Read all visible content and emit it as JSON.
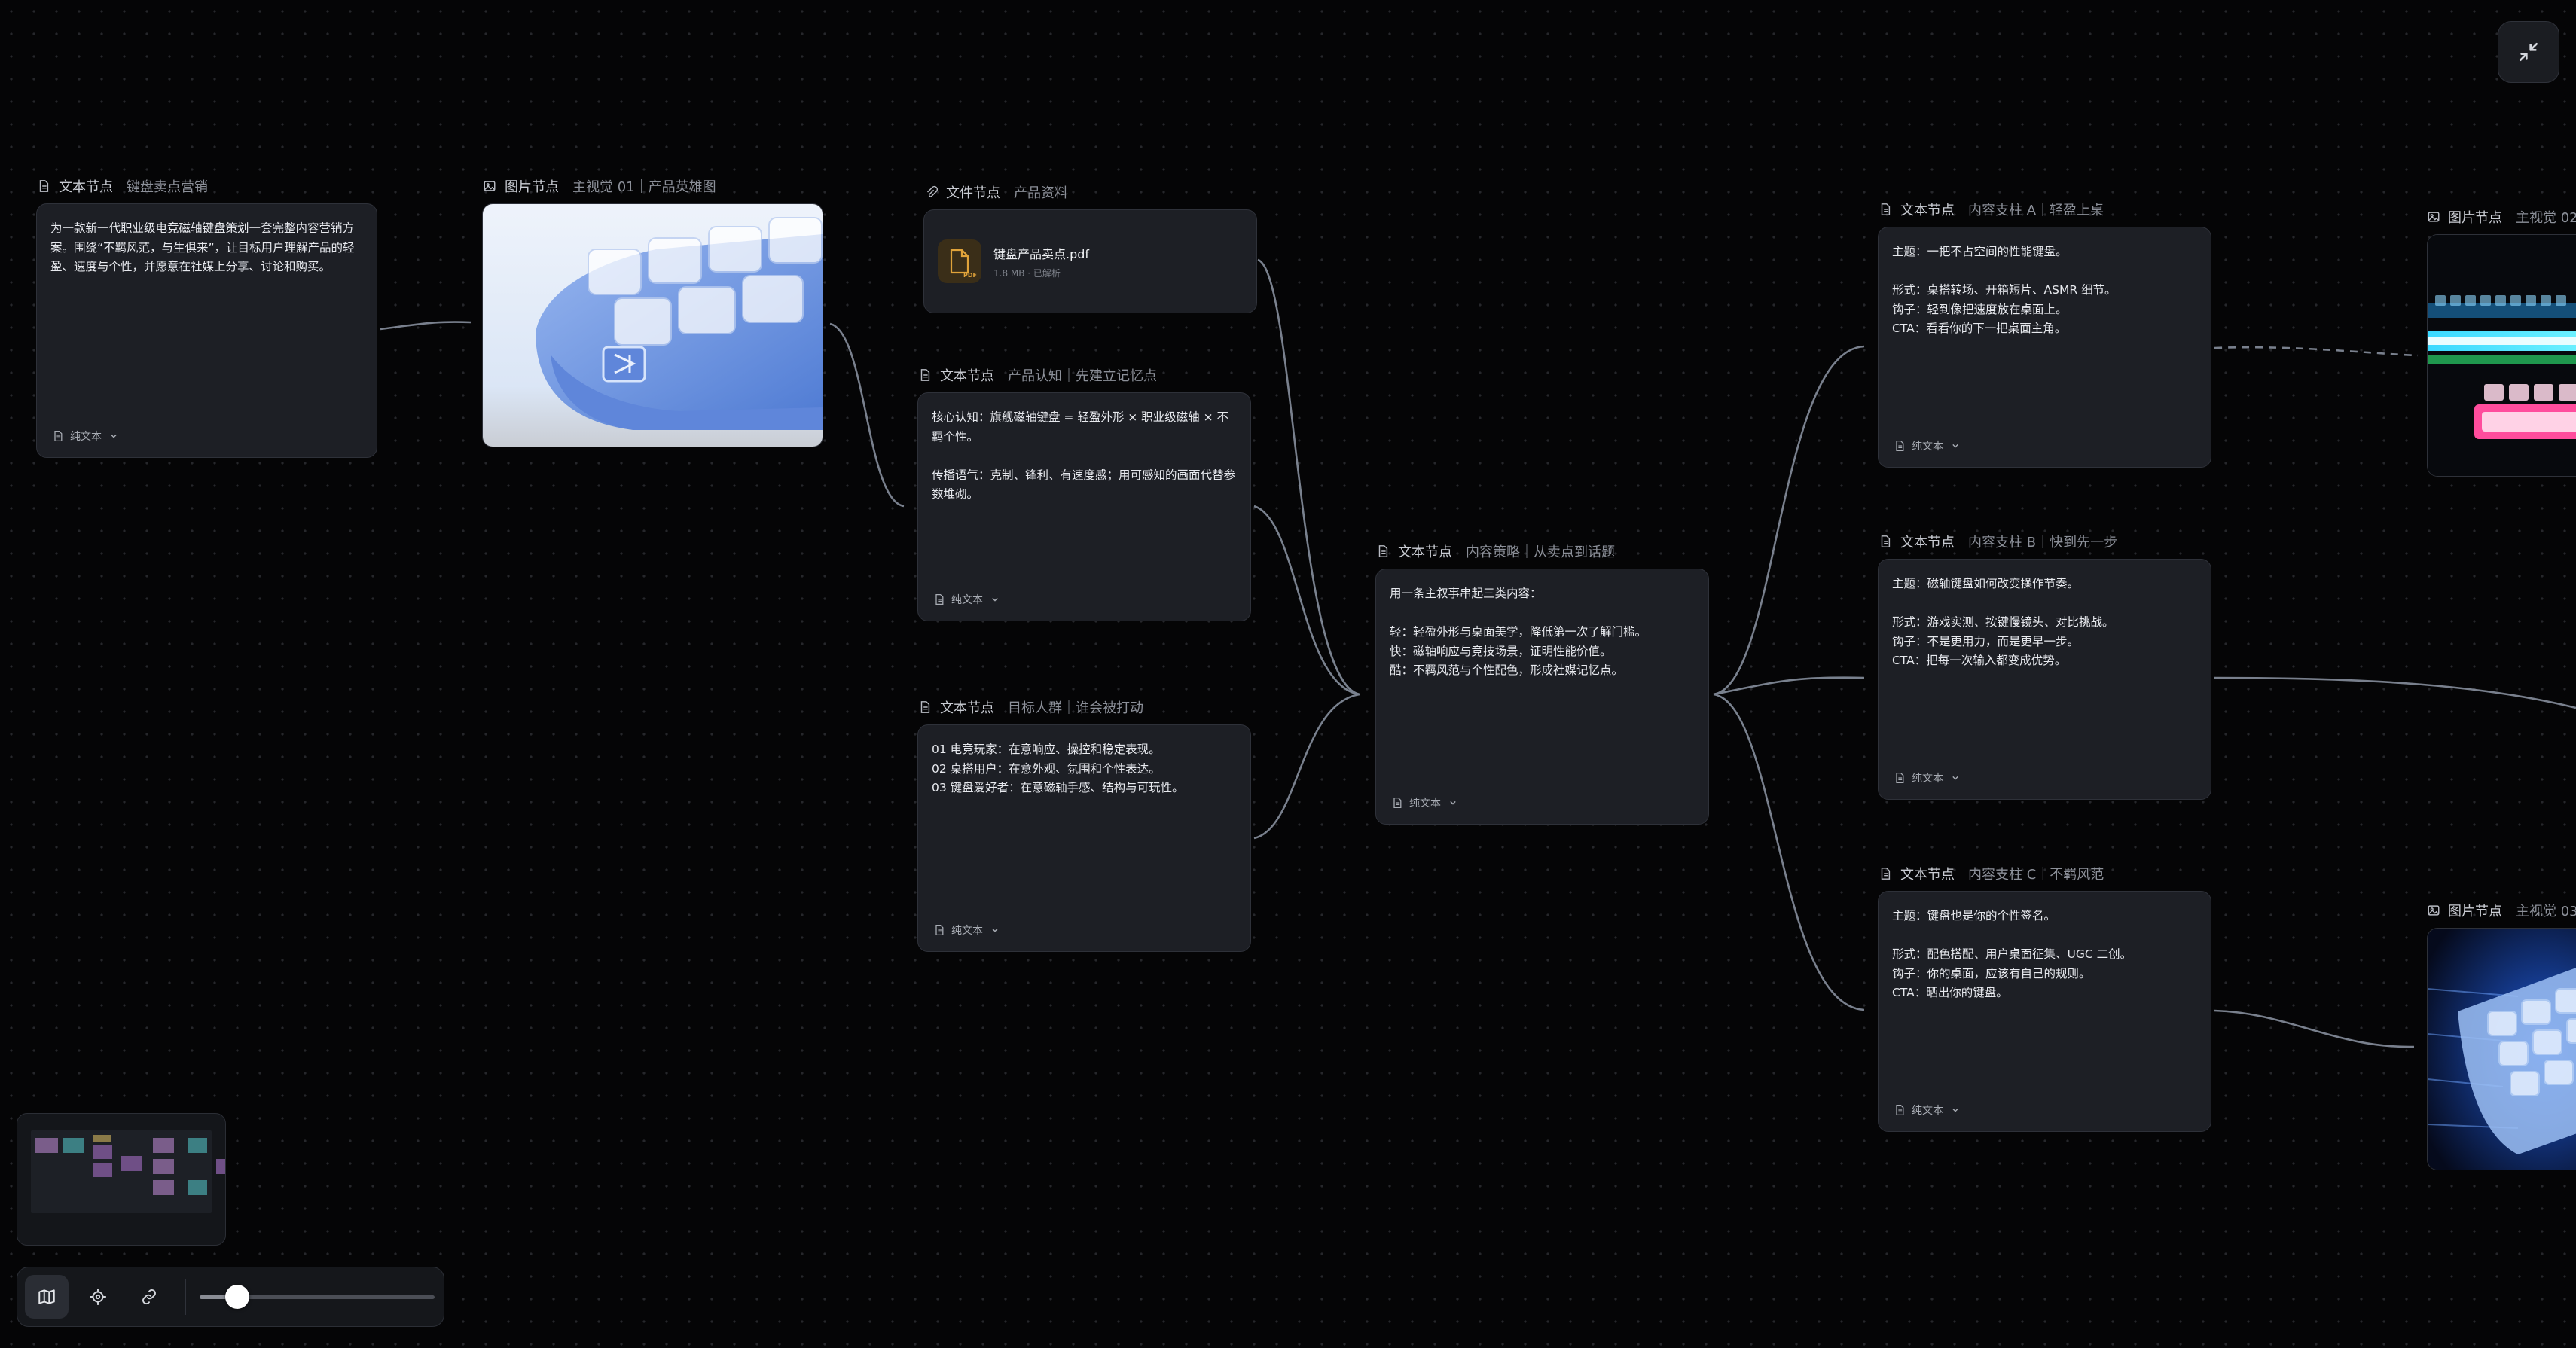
{
  "nodes": {
    "marketing": {
      "type": "文本节点",
      "title": "键盘卖点营销",
      "body": "为一款新一代职业级电竞磁轴键盘策划一套完整内容营销方案。围绕“不羁风范，与生俱来”，让目标用户理解产品的轻盈、速度与个性，并愿意在社媒上分享、讨论和购买。",
      "format": "纯文本"
    },
    "hero_image": {
      "type": "图片节点",
      "title": "主视觉 01｜产品英雄图"
    },
    "file": {
      "type": "文件节点",
      "title": "产品资料",
      "file_name": "键盘产品卖点.pdf",
      "file_meta": "1.8 MB · 已解析",
      "file_badge": "PDF"
    },
    "cognition": {
      "type": "文本节点",
      "title": "产品认知｜先建立记忆点",
      "body": "核心认知：旗舰磁轴键盘 = 轻盈外形 × 职业级磁轴 × 不羁个性。\n\n传播语气：克制、锋利、有速度感；用可感知的画面代替参数堆砌。",
      "format": "纯文本"
    },
    "audience": {
      "type": "文本节点",
      "title": "目标人群｜谁会被打动",
      "body": "01 电竞玩家：在意响应、操控和稳定表现。\n02 桌搭用户：在意外观、氛围和个性表达。\n03 键盘爱好者：在意磁轴手感、结构与可玩性。",
      "format": "纯文本"
    },
    "strategy": {
      "type": "文本节点",
      "title": "内容策略｜从卖点到话题",
      "body": "用一条主叙事串起三类内容：\n\n轻：轻盈外形与桌面美学，降低第一次了解门槛。\n快：磁轴响应与竞技场景，证明性能价值。\n酷：不羁风范与个性配色，形成社媒记忆点。",
      "format": "纯文本"
    },
    "pillar_a": {
      "type": "文本节点",
      "title": "内容支柱 A｜轻盈上桌",
      "body": "主题：一把不占空间的性能键盘。\n\n形式：桌搭转场、开箱短片、ASMR 细节。\n钩子：轻到像把速度放在桌面上。\nCTA：看看你的下一把桌面主角。",
      "format": "纯文本"
    },
    "pillar_b": {
      "type": "文本节点",
      "title": "内容支柱 B｜快到先一步",
      "body": "主题：磁轴键盘如何改变操作节奏。\n\n形式：游戏实测、按键慢镜头、对比挑战。\n钩子：不是更用力，而是更早一步。\nCTA：把每一次输入都变成优势。",
      "format": "纯文本"
    },
    "pillar_c": {
      "type": "文本节点",
      "title": "内容支柱 C｜不羁风范",
      "body": "主题：键盘也是你的个性签名。\n\n形式：配色搭配、用户桌面征集、UGC 二创。\n钩子：你的桌面，应该有自己的规则。\nCTA：晒出你的键盘。",
      "format": "纯文本"
    },
    "image_02": {
      "type": "图片节点",
      "title": "主视觉 02"
    },
    "image_03": {
      "type": "图片节点",
      "title": "主视觉 03"
    }
  },
  "toolbar": {
    "zoom_fraction": 0.16
  },
  "colors": {
    "canvas": "#050506",
    "card": "#1d1f25",
    "edge": "#8e97a6",
    "accent_file": "#e0a33a"
  },
  "icons": [
    "text-node-icon",
    "image-node-icon",
    "file-node-icon",
    "pdf-file-icon",
    "collapse-icon",
    "map-icon",
    "locate-icon",
    "link-icon",
    "chevron-down-icon"
  ]
}
